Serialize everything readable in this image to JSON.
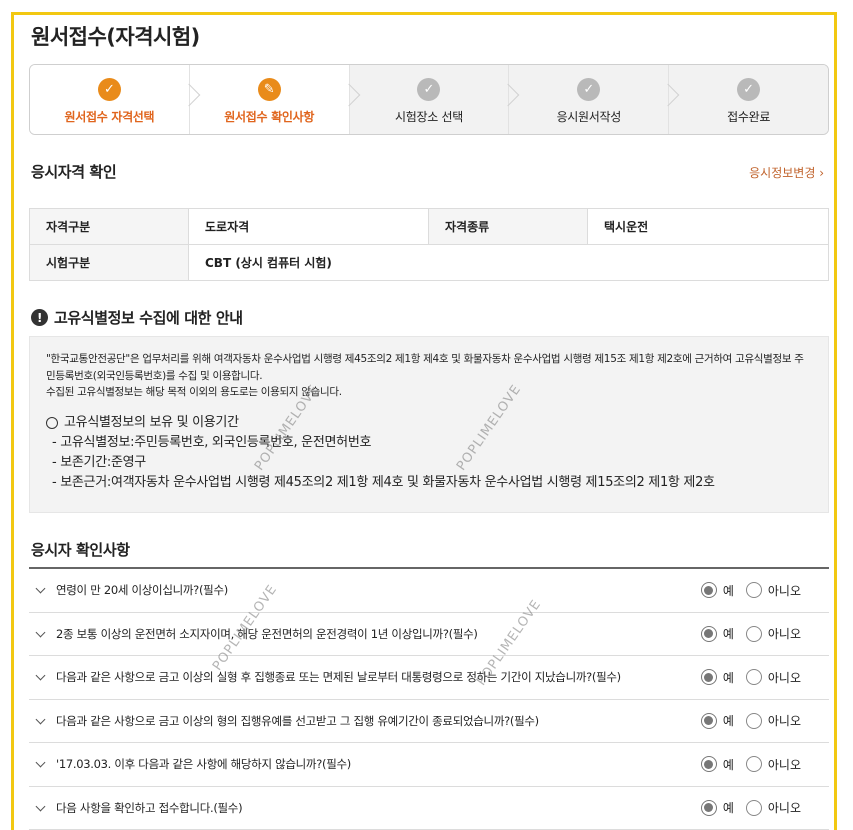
{
  "page_title": "원서접수(자격시험)",
  "steps": [
    {
      "label": "원서접수 자격선택",
      "state": "done",
      "icon": "check-icon"
    },
    {
      "label": "원서접수 확인사항",
      "state": "active",
      "icon": "pencil-icon"
    },
    {
      "label": "시험장소 선택",
      "state": "pending",
      "icon": "check-icon"
    },
    {
      "label": "응시원서작성",
      "state": "pending",
      "icon": "check-icon"
    },
    {
      "label": "접수완료",
      "state": "pending",
      "icon": "check-icon"
    }
  ],
  "qualification": {
    "title": "응시자격 확인",
    "change_link": "응시정보변경 ›",
    "rows": [
      [
        {
          "h": "자격구분",
          "v": "도로자격"
        },
        {
          "h": "자격종류",
          "v": "택시운전"
        }
      ],
      [
        {
          "h": "시험구분",
          "v": "CBT (상시 컴퓨터 시험)"
        }
      ]
    ]
  },
  "notice": {
    "title": "고유식별정보 수집에 대한 안내",
    "paragraph1": "\"한국교통안전공단\"은 업무처리를 위해 여객자동차 운수사업법 시행령 제45조의2 제1항 제4호 및 화물자동차 운수사업법 시행령 제15조 제1항 제2호에 근거하여 고유식별정보 주민등록번호(외국인등록번호)를 수집 및 이용합니다.",
    "paragraph2": "수집된 고유식별정보는 해당 목적 이외의 용도로는 이용되지 않습니다.",
    "retention_title": "고유식별정보의 보유 및 이용기간",
    "retention_lines": [
      "- 고유식별정보:주민등록번호, 외국인등록번호, 운전면허번호",
      "- 보존기간:준영구",
      "- 보존근거:여객자동차 운수사업법 시행령 제45조의2 제1항 제4호 및 화물자동차 운수사업법 시행령 제15조의2 제1항 제2호"
    ]
  },
  "confirm": {
    "title": "응시자 확인사항",
    "yes_label": "예",
    "no_label": "아니오",
    "items": [
      {
        "text": "연령이 만 20세 이상이십니까?(필수)",
        "selected": "yes"
      },
      {
        "text": "2종 보통 이상의 운전면허 소지자이며, 해당 운전면허의 운전경력이 1년 이상입니까?(필수)",
        "selected": "yes"
      },
      {
        "text": "다음과 같은 사항으로 금고 이상의 실형 후 집행종료 또는 면제된 날로부터 대통령령으로 정하는 기간이 지났습니까?(필수)",
        "selected": "yes"
      },
      {
        "text": "다음과 같은 사항으로 금고 이상의 형의 집행유예를 선고받고 그 집행 유예기간이 종료되었습니까?(필수)",
        "selected": "yes"
      },
      {
        "text": "'17.03.03. 이후 다음과 같은 사항에 해당하지 않습니까?(필수)",
        "selected": "yes"
      },
      {
        "text": "다음 사항을 확인하고 접수합니다.(필수)",
        "selected": "yes"
      }
    ]
  },
  "watermark": "POPLIMELOVE",
  "colors": {
    "accent": "#e98b1a",
    "accent_text": "#e0651d",
    "frame": "#f2c811",
    "link": "#c0622b"
  }
}
